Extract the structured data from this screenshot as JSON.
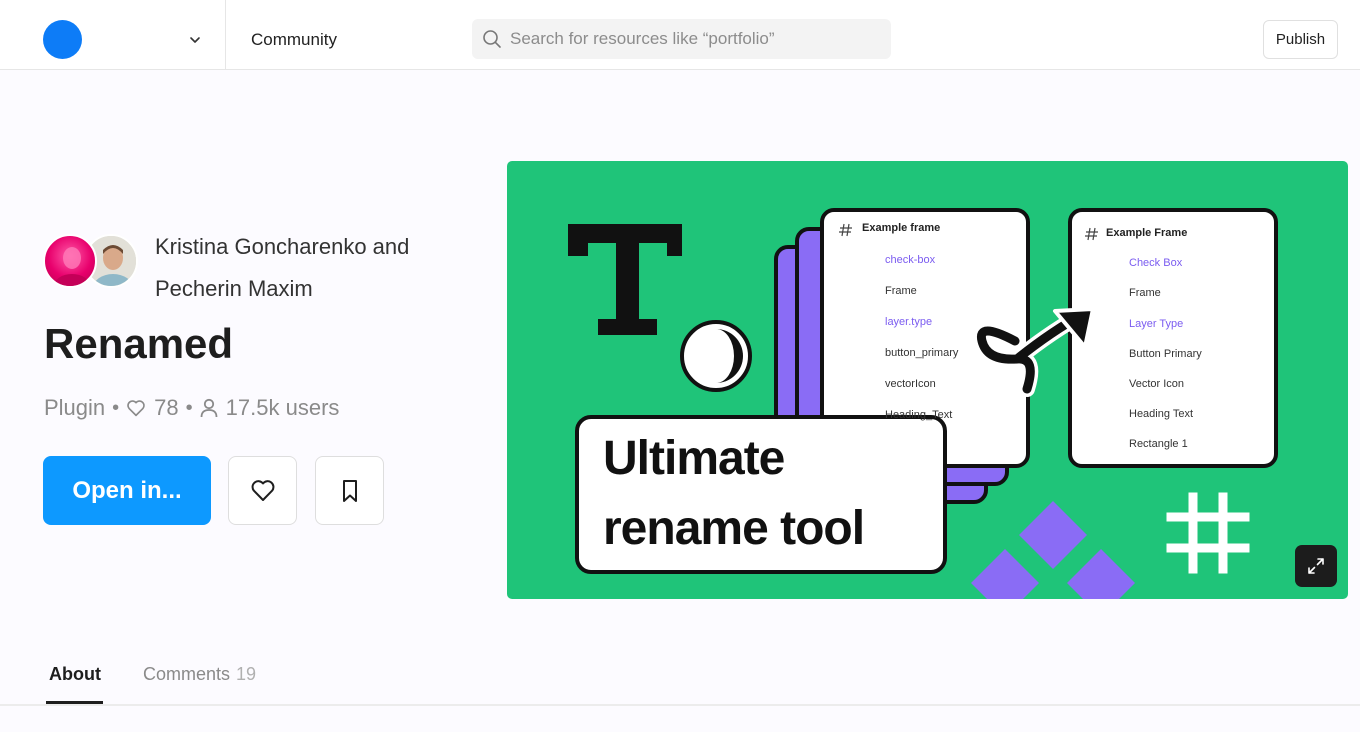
{
  "header": {
    "nav_community": "Community",
    "search_placeholder": "Search for resources like “portfolio”",
    "publish_label": "Publish"
  },
  "resource": {
    "authors": "Kristina Goncharenko and Pecherin Maxim",
    "title": "Renamed",
    "type": "Plugin",
    "likes": "78",
    "users": "17.5k users",
    "open_label": "Open in..."
  },
  "hero": {
    "caption_line1": "Ultimate",
    "caption_line2": "rename tool",
    "panel_left": {
      "header": "Example frame",
      "items": [
        "check-box",
        "Frame",
        "layer.type",
        "button_primary",
        "vectorIcon",
        "Heading_Text"
      ]
    },
    "panel_right": {
      "header": "Example Frame",
      "items": [
        "Check Box",
        "Frame",
        "Layer Type",
        "Button Primary",
        "Vector Icon",
        "Heading Text",
        "Rectangle 1"
      ]
    }
  },
  "tabs": {
    "about": "About",
    "comments": "Comments",
    "comments_count": "19"
  },
  "colors": {
    "accent": "#0d99ff",
    "hero_bg": "#1fc479",
    "purple": "#8a6cf5",
    "logo": "#0d7cf7"
  }
}
